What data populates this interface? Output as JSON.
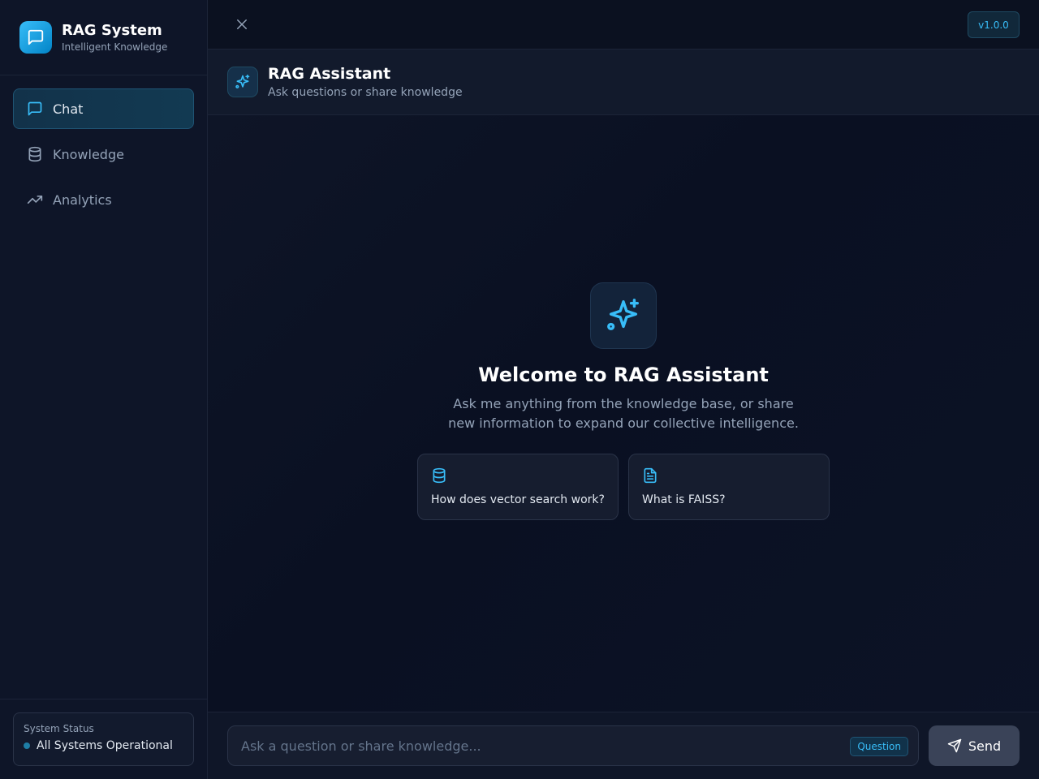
{
  "brand": {
    "title": "RAG System",
    "subtitle": "Intelligent Knowledge",
    "icon": "message-square-icon"
  },
  "nav": {
    "items": [
      {
        "label": "Chat",
        "icon": "message-square-icon",
        "active": true
      },
      {
        "label": "Knowledge",
        "icon": "database-icon",
        "active": false
      },
      {
        "label": "Analytics",
        "icon": "trending-up-icon",
        "active": false
      }
    ]
  },
  "status": {
    "label": "System Status",
    "text": "All Systems Operational"
  },
  "topbar": {
    "version": "v1.0.0"
  },
  "chat_header": {
    "title": "RAG Assistant",
    "subtitle": "Ask questions or share knowledge"
  },
  "welcome": {
    "title": "Welcome to RAG Assistant",
    "text": "Ask me anything from the knowledge base, or share new information to expand our collective intelligence.",
    "suggestions": [
      {
        "icon": "database-icon",
        "text": "How does vector search work?"
      },
      {
        "icon": "file-text-icon",
        "text": "What is FAISS?"
      }
    ]
  },
  "composer": {
    "placeholder": "Ask a question or share knowledge...",
    "value": "",
    "mode_badge": "Question",
    "send_label": "Send"
  },
  "colors": {
    "accent": "#38bdf8",
    "background": "#0b1120",
    "sidebar": "#0e1528"
  }
}
